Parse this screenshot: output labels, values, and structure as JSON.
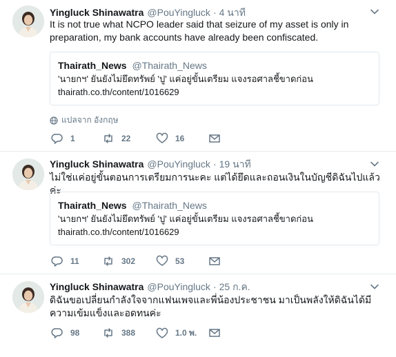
{
  "tweets": [
    {
      "name": "Yingluck Shinawatra",
      "handle": "@PouYingluck",
      "sep": "·",
      "time": "4 นาที",
      "text": "It is not true what NCPO leader said that seizure of my asset is only in preparation, my bank accounts have already been confiscated.",
      "quote": {
        "name": "Thairath_News",
        "handle": "@Thairath_News",
        "line1": "'นายกฯ' ยันยังไม่ยึดทรัพย์ 'ปู' แค่อยู่ขั้นเตรียม แจงรอศาลชี้ขาดก่อน",
        "line2": "thairath.co.th/content/1016629"
      },
      "translate": "แปลจาก อังกฤษ",
      "replies": "1",
      "retweets": "22",
      "likes": "16"
    },
    {
      "name": "Yingluck Shinawatra",
      "handle": "@PouYingluck",
      "sep": "·",
      "time": "19 นาที",
      "text": "ไม่ใช่แค่อยู่ขั้นตอนการเตรียมการนะคะ แต่ได้ยึดและถอนเงินในบัญชีดิฉันไปแล้วค่ะ",
      "quote": {
        "name": "Thairath_News",
        "handle": "@Thairath_News",
        "line1": "'นายกฯ' ยันยังไม่ยึดทรัพย์ 'ปู' แค่อยู่ขั้นเตรียม แจงรอศาลชี้ขาดก่อน",
        "line2": "thairath.co.th/content/1016629"
      },
      "replies": "11",
      "retweets": "302",
      "likes": "53"
    },
    {
      "name": "Yingluck Shinawatra",
      "handle": "@PouYingluck",
      "sep": "·",
      "time": "25 ก.ค.",
      "text": "ดิฉันขอเปลี่ยนกำลังใจจากแฟนเพจและพี่น้องประชาชน มาเป็นพลังให้ดิฉันได้มีความเข้มแข็งและอดทนค่ะ",
      "replies": "98",
      "retweets": "388",
      "likes": "1.0 พ."
    }
  ],
  "icons": {
    "reply": "reply-icon",
    "retweet": "retweet-icon",
    "like": "heart-icon",
    "dm": "envelope-icon",
    "caret": "chevron-down-icon",
    "globe": "globe-icon"
  },
  "colors": {
    "text": "#14171a",
    "secondary": "#657786",
    "border": "#e6ecf0"
  }
}
